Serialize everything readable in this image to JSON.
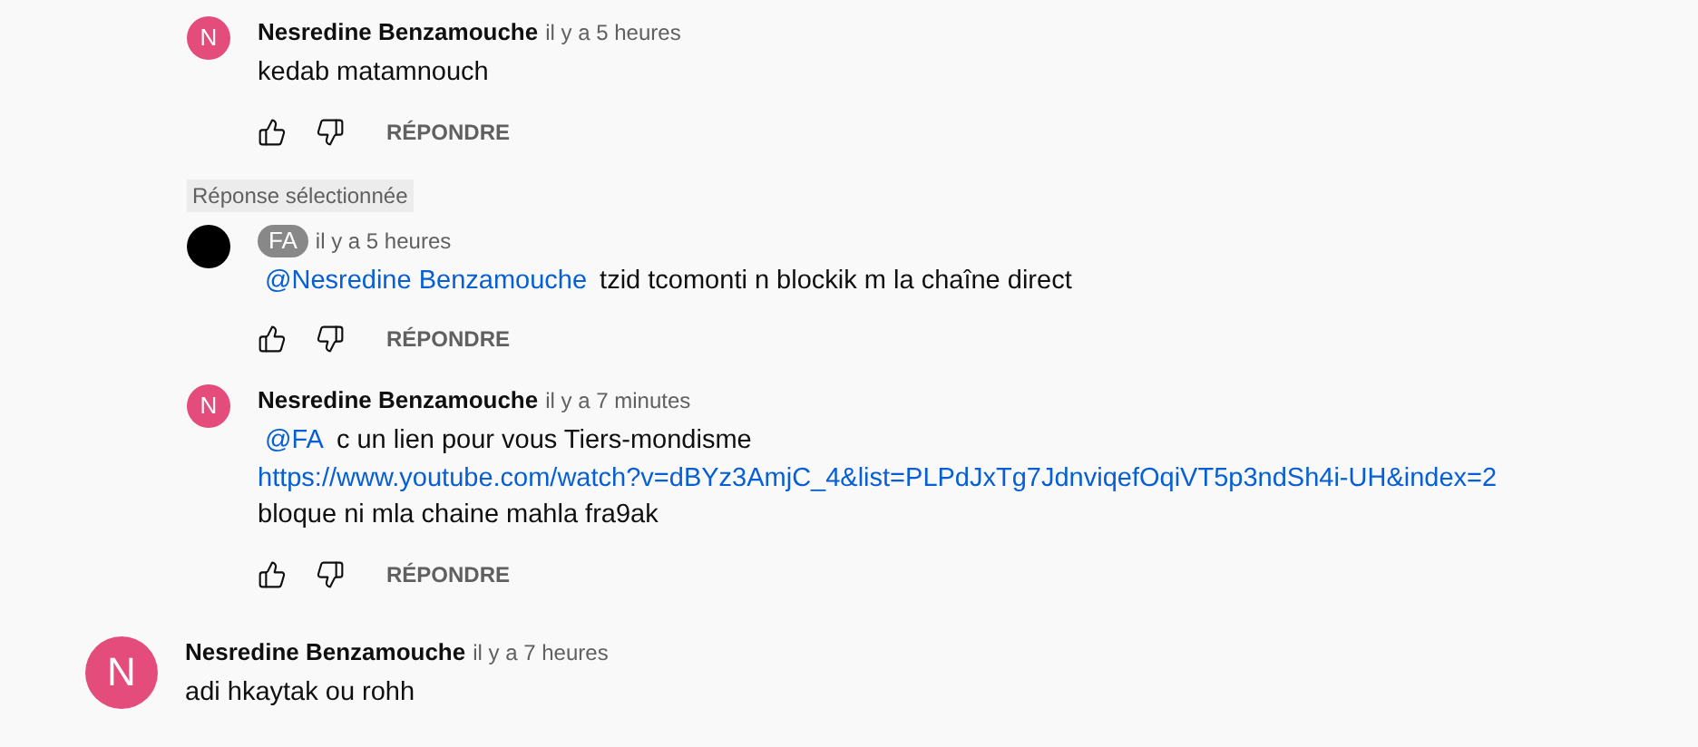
{
  "comments": [
    {
      "kind": "reply",
      "author": "Nesredine Benzamouche",
      "author_highlighted": false,
      "avatar": {
        "letter": "N",
        "color": "#e44c7c"
      },
      "time": "il y a 5 heures",
      "lines": [
        [
          {
            "kind": "text",
            "text": "kedab matamnouch"
          }
        ]
      ],
      "reply_label": "RÉPONDRE"
    },
    {
      "kind": "reply",
      "selected_label": "Réponse sélectionnée",
      "author": "FA",
      "author_highlighted": true,
      "avatar": {
        "color": "#000000"
      },
      "time": "il y a 5 heures",
      "lines": [
        [
          {
            "kind": "mention",
            "text": "@Nesredine Benzamouche"
          },
          {
            "kind": "text",
            "text": "tzid tcomonti n blockik m la chaîne direct"
          }
        ]
      ],
      "reply_label": "RÉPONDRE"
    },
    {
      "kind": "reply",
      "author": "Nesredine Benzamouche",
      "author_highlighted": false,
      "avatar": {
        "letter": "N",
        "color": "#e44c7c"
      },
      "time": "il y a 7 minutes",
      "lines": [
        [
          {
            "kind": "mention",
            "text": "@FA"
          },
          {
            "kind": "text",
            "text": "c un lien pour vous Tiers-mondisme"
          }
        ],
        [
          {
            "kind": "link",
            "text": "https://www.youtube.com/watch?v=dBYz3AmjC_4&list=PLPdJxTg7JdnviqefOqiVT5p3ndSh4i-UH&index=2"
          }
        ],
        [
          {
            "kind": "text",
            "text": "bloque ni mla chaine mahla fra9ak"
          }
        ]
      ],
      "reply_label": "RÉPONDRE"
    },
    {
      "kind": "top",
      "author": "Nesredine Benzamouche",
      "author_highlighted": false,
      "avatar": {
        "letter": "N",
        "color": "#e44c7c"
      },
      "time": "il y a 7 heures",
      "lines": [
        [
          {
            "kind": "text",
            "text": "adi hkaytak ou rohh"
          }
        ]
      ]
    }
  ]
}
